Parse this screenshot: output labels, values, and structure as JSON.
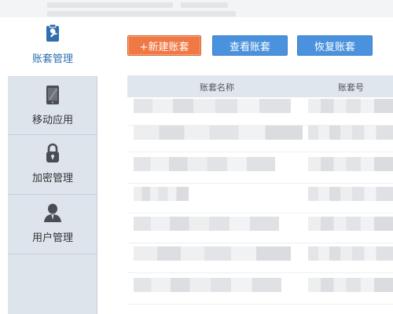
{
  "sidebar": {
    "items": [
      {
        "label": "账套管理",
        "icon": "wrench-clipboard-icon",
        "active": true
      },
      {
        "label": "移动应用",
        "icon": "mobile-phone-icon",
        "active": false
      },
      {
        "label": "加密管理",
        "icon": "padlock-icon",
        "active": false
      },
      {
        "label": "用户管理",
        "icon": "user-icon",
        "active": false
      }
    ]
  },
  "toolbar": {
    "new_label": "+新建账套",
    "view_label": "查看账套",
    "restore_label": "恢复账套"
  },
  "table": {
    "columns": [
      "账套名称",
      "账套号"
    ],
    "row_count_visible": 7
  },
  "colors": {
    "accent_orange": "#f07844",
    "accent_blue": "#4a92dd",
    "sidebar_bg": "#dde4ec"
  }
}
